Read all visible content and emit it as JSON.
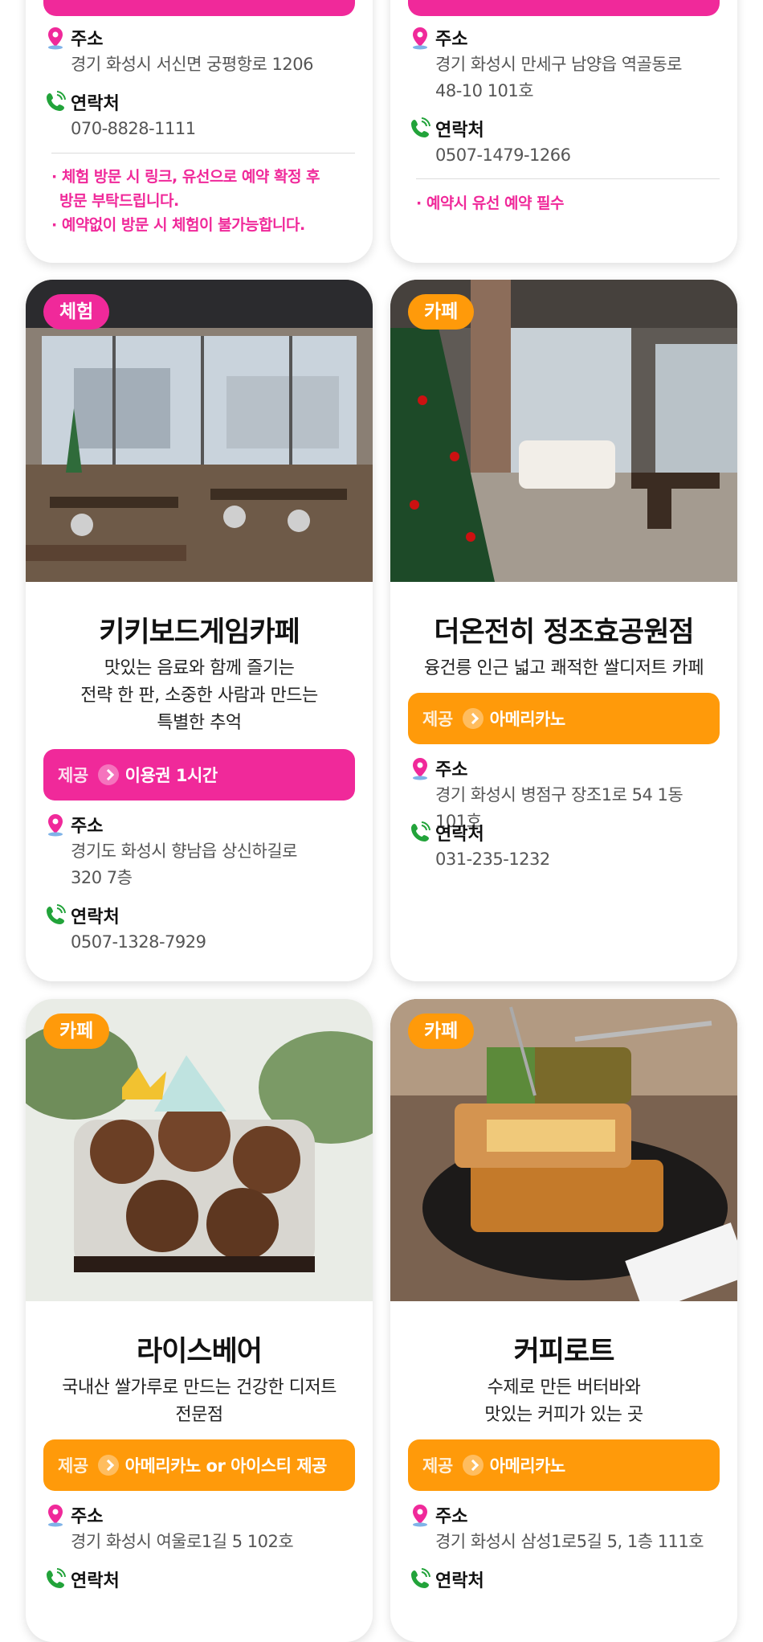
{
  "labels": {
    "address": "주소",
    "contact": "연락처",
    "offer": "제공"
  },
  "colors": {
    "pink": "#f0299a",
    "orange": "#ff9a0a"
  },
  "top_cards": [
    {
      "address": [
        "경기 화성시 서신면 궁평항로 1206"
      ],
      "contact": "070-8828-1111",
      "notes": [
        "· 체험 방문 시 링크, 유선으로 예약 확정 후",
        "방문 부탁드립니다.",
        "· 예약없이 방문 시 체험이 불가능합니다."
      ]
    },
    {
      "address": [
        "경기 화성시 만세구 남양읍 역골동로",
        "48-10 101호"
      ],
      "contact": "0507-1479-1266",
      "notes": [
        "· 예약시 유선 예약 필수"
      ]
    }
  ],
  "cards": [
    {
      "tag": "체험",
      "title": "키키보드게임카페",
      "desc": [
        "맛있는 음료와 함께 즐기는",
        "전략 한 판, 소중한 사람과 만드는",
        "특별한 추억"
      ],
      "offer": "이용권 1시간",
      "address": [
        "경기도 화성시 향남읍 상신하길로",
        "320 7층"
      ],
      "contact": "0507-1328-7929"
    },
    {
      "tag": "카페",
      "title": "더온전히 정조효공원점",
      "desc": [
        "융건릉 인근 넓고 쾌적한 쌀디저트 카페"
      ],
      "offer": "아메리카노",
      "address": [
        "경기 화성시 병점구 장조1로 54 1동 101호"
      ],
      "contact": "031-235-1232"
    },
    {
      "tag": "카페",
      "title": "라이스베어",
      "desc": [
        "국내산 쌀가루로 만드는 건강한 디저트",
        "전문점"
      ],
      "offer": "아메리카노 or 아이스티 제공",
      "address": [
        "경기 화성시 여울로1길 5 102호"
      ],
      "contact": ""
    },
    {
      "tag": "카페",
      "title": "커피로트",
      "desc": [
        "수제로 만든 버터바와",
        "맛있는 커피가 있는 곳"
      ],
      "offer": "아메리카노",
      "address": [
        "경기 화성시 삼성1로5길 5, 1층 111호"
      ],
      "contact": ""
    }
  ]
}
